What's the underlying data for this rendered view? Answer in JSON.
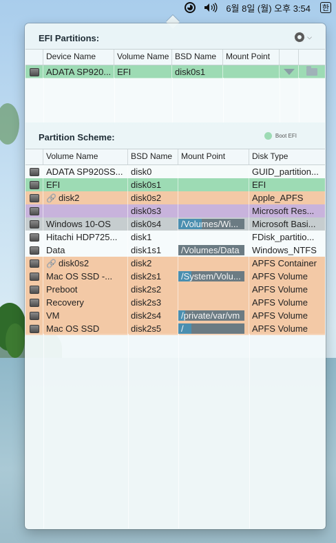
{
  "menubar": {
    "volume_icon": "speaker-icon",
    "clock": "6월 8일 (월) 오후 3:54",
    "input_source": "한"
  },
  "efi": {
    "title": "EFI Partitions:",
    "columns": [
      "Device Name",
      "Volume Name",
      "BSD Name",
      "Mount Point"
    ],
    "row": {
      "device_name": "ADATA SP920...",
      "volume_name": "EFI",
      "bsd_name": "disk0s1",
      "mount_point": ""
    }
  },
  "scheme": {
    "title": "Partition Scheme:",
    "legend": "Boot EFI",
    "columns": [
      "Volume Name",
      "BSD Name",
      "Mount Point",
      "Disk Type"
    ],
    "rows": [
      {
        "volume": "ADATA SP920SS...",
        "bsd": "disk0",
        "mount": "",
        "type": "GUID_partition...",
        "color": "plain",
        "link": false
      },
      {
        "volume": "EFI",
        "bsd": "disk0s1",
        "mount": "",
        "type": "EFI",
        "color": "efi-green",
        "link": false
      },
      {
        "volume": "disk2",
        "bsd": "disk0s2",
        "mount": "",
        "type": "Apple_APFS",
        "color": "apple-orange",
        "link": true
      },
      {
        "volume": "",
        "bsd": "disk0s3",
        "mount": "",
        "type": "Microsoft Res...",
        "color": "ms-purple",
        "link": false
      },
      {
        "volume": "Windows 10-OS",
        "bsd": "disk0s4",
        "mount": "/Volumes/Wi...",
        "type": "Microsoft Basi...",
        "color": "win-grey",
        "link": false,
        "usage": 0.35
      },
      {
        "volume": "Hitachi HDP725...",
        "bsd": "disk1",
        "mount": "",
        "type": "FDisk_partitio...",
        "color": "plain",
        "link": false
      },
      {
        "volume": "Data",
        "bsd": "disk1s1",
        "mount": "/Volumes/Data",
        "type": "Windows_NTFS",
        "color": "plain",
        "link": false,
        "usage": 0.0
      },
      {
        "volume": "disk0s2",
        "bsd": "disk2",
        "mount": "",
        "type": "APFS Container",
        "color": "apple-orange",
        "link": true
      },
      {
        "volume": "Mac OS SSD -...",
        "bsd": "disk2s1",
        "mount": "/System/Volu...",
        "type": "APFS Volume",
        "color": "apple-orange",
        "link": false,
        "usage": 0.2
      },
      {
        "volume": "Preboot",
        "bsd": "disk2s2",
        "mount": "",
        "type": "APFS Volume",
        "color": "apple-orange",
        "link": false
      },
      {
        "volume": "Recovery",
        "bsd": "disk2s3",
        "mount": "",
        "type": "APFS Volume",
        "color": "apple-orange",
        "link": false
      },
      {
        "volume": "VM",
        "bsd": "disk2s4",
        "mount": "/private/var/vm",
        "type": "APFS Volume",
        "color": "apple-orange",
        "link": false,
        "usage": 0.1
      },
      {
        "volume": "Mac OS SSD",
        "bsd": "disk2s5",
        "mount": "/",
        "type": "APFS Volume",
        "color": "apple-orange",
        "link": false,
        "usage": 0.2
      }
    ]
  }
}
